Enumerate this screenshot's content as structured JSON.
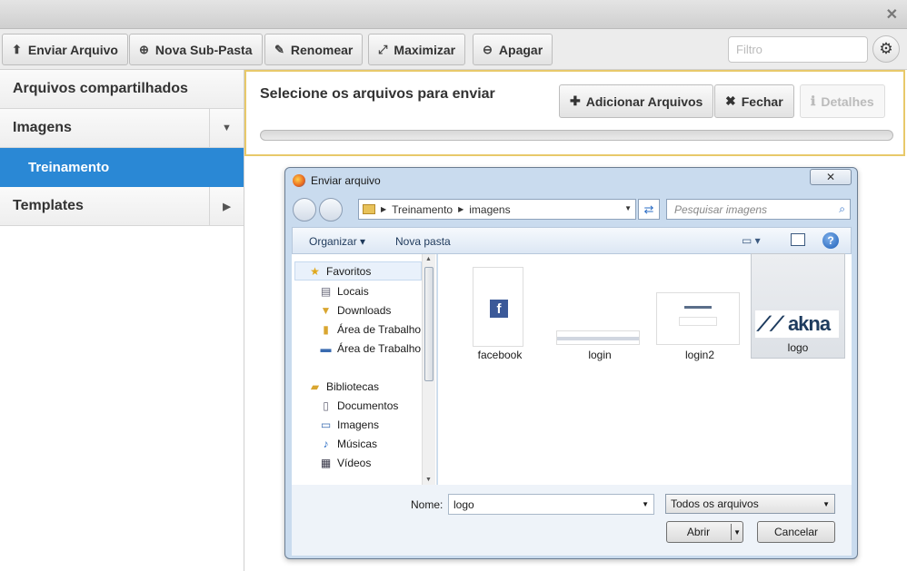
{
  "window": {
    "close_glyph": "✕"
  },
  "toolbar": {
    "buttons": [
      {
        "label": "Enviar Arquivo",
        "icon": "upload-icon",
        "glyph": "⬆"
      },
      {
        "label": "Nova Sub-Pasta",
        "icon": "new-folder-icon",
        "glyph": "⊕"
      },
      {
        "label": "Renomear",
        "icon": "rename-icon",
        "glyph": "✎"
      },
      {
        "label": "Maximizar",
        "icon": "maximize-icon",
        "glyph": "⤢"
      },
      {
        "label": "Apagar",
        "icon": "delete-icon",
        "glyph": "⊖"
      }
    ],
    "filter_placeholder": "Filtro",
    "settings_glyph": "⚙"
  },
  "sidebar": {
    "items": [
      {
        "label": "Arquivos compartilhados"
      },
      {
        "label": "Imagens",
        "arrow": "▼"
      },
      {
        "label": "Treinamento"
      },
      {
        "label": "Templates",
        "arrow": "▶"
      }
    ]
  },
  "upload": {
    "title": "Selecione os arquivos para enviar",
    "add_label": "Adicionar Arquivos",
    "add_glyph": "✚",
    "close_label": "Fechar",
    "close_glyph": "✖",
    "details_label": "Detalhes",
    "details_glyph": "ℹ",
    "progress": 0
  },
  "dialog": {
    "title": "Enviar arquivo",
    "close_glyph": "✕",
    "breadcrumb": [
      "Treinamento",
      "imagens"
    ],
    "search_placeholder": "Pesquisar imagens",
    "commands": {
      "organize": "Organizar ▾",
      "new_folder": "Nova pasta"
    },
    "help_glyph": "?",
    "nav": {
      "favorites": "Favoritos",
      "fav_items": [
        "Locais",
        "Downloads",
        "Área de Trabalho",
        "Área de Trabalho"
      ],
      "libraries": "Bibliotecas",
      "lib_items": [
        "Documentos",
        "Imagens",
        "Músicas",
        "Vídeos"
      ]
    },
    "files": [
      {
        "name": "facebook"
      },
      {
        "name": "login"
      },
      {
        "name": "login2"
      },
      {
        "name": "logo"
      }
    ],
    "logo_text": "akna",
    "fb_glyph": "f",
    "name_label": "Nome:",
    "name_value": "logo",
    "type_value": "Todos os arquivos",
    "open_label": "Abrir",
    "cancel_label": "Cancelar"
  },
  "colors": {
    "accent": "#2a88d5",
    "highlight_border": "#e8c96a",
    "dialog_frame": "#c9dbee"
  }
}
